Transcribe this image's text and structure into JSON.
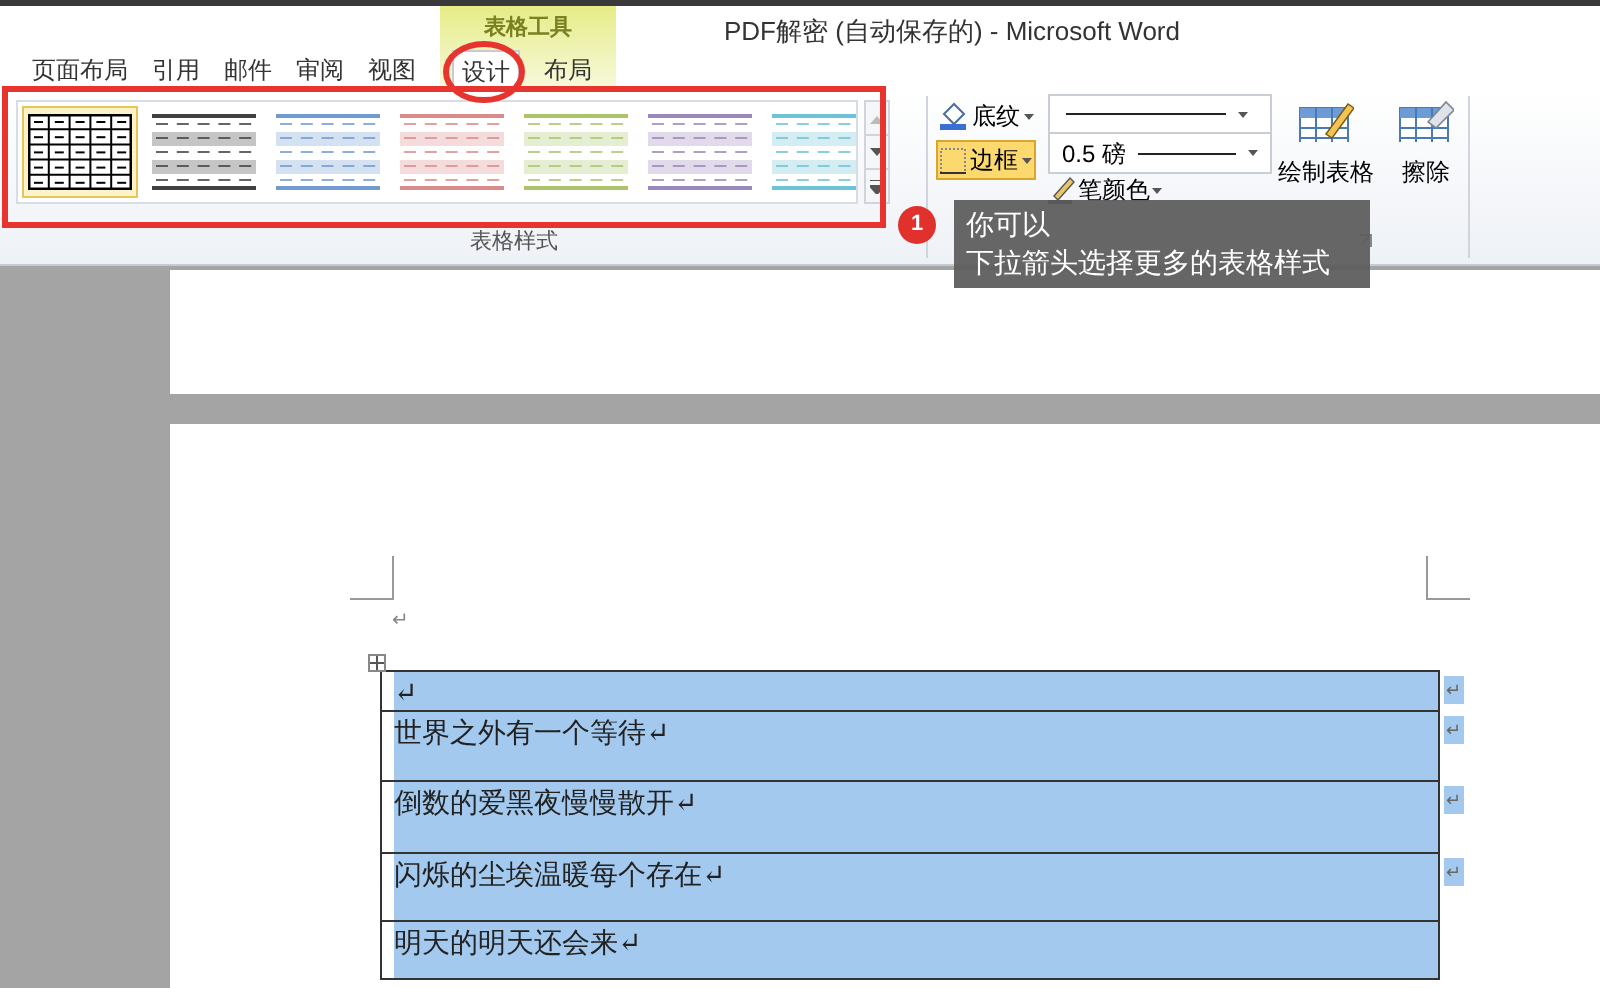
{
  "window": {
    "title": "PDF解密 (自动保存的) - Microsoft Word"
  },
  "tabs": [
    {
      "label": "页面布局",
      "selected": false
    },
    {
      "label": "引用",
      "selected": false
    },
    {
      "label": "邮件",
      "selected": false
    },
    {
      "label": "审阅",
      "selected": false
    },
    {
      "label": "视图",
      "selected": false
    }
  ],
  "contextual_tab_group": {
    "label": "表格工具",
    "tabs": [
      {
        "label": "设计",
        "selected": true
      },
      {
        "label": "布局",
        "selected": false
      }
    ]
  },
  "table_styles": {
    "label": "表格样式",
    "styles": [
      {
        "kind": "grid",
        "color": "#000000",
        "selected": true
      },
      {
        "kind": "banded",
        "color": "#404040",
        "selected": false
      },
      {
        "kind": "banded",
        "color": "#6f9bd1",
        "selected": false
      },
      {
        "kind": "banded",
        "color": "#d98a8a",
        "selected": false
      },
      {
        "kind": "banded",
        "color": "#a9c46a",
        "selected": false
      },
      {
        "kind": "banded",
        "color": "#9c86ba",
        "selected": false
      },
      {
        "kind": "banded",
        "color": "#6cc3d6",
        "selected": false
      }
    ]
  },
  "draw_borders": {
    "shading": {
      "label": "底纹",
      "active": false
    },
    "borders": {
      "label": "边框",
      "active": true
    },
    "line_weight": "0.5 磅",
    "pen_color": "笔颜色",
    "draw_table": "绘制表格",
    "eraser": "擦除"
  },
  "callout": {
    "number": "1",
    "lines": [
      "你可以",
      "下拉箭头选择更多的表格样式"
    ]
  },
  "document": {
    "paragraph_mark": "↵",
    "rows": [
      {
        "text": "↵",
        "end_mark": "↵"
      },
      {
        "text": "世界之外有一个等待↵",
        "end_mark": "↵"
      },
      {
        "text": "倒数的爱黑夜慢慢散开↵",
        "end_mark": "↵"
      },
      {
        "text": "闪烁的尘埃温暖每个存在↵",
        "end_mark": "↵"
      },
      {
        "text": "明天的明天还会来↵"
      }
    ]
  }
}
